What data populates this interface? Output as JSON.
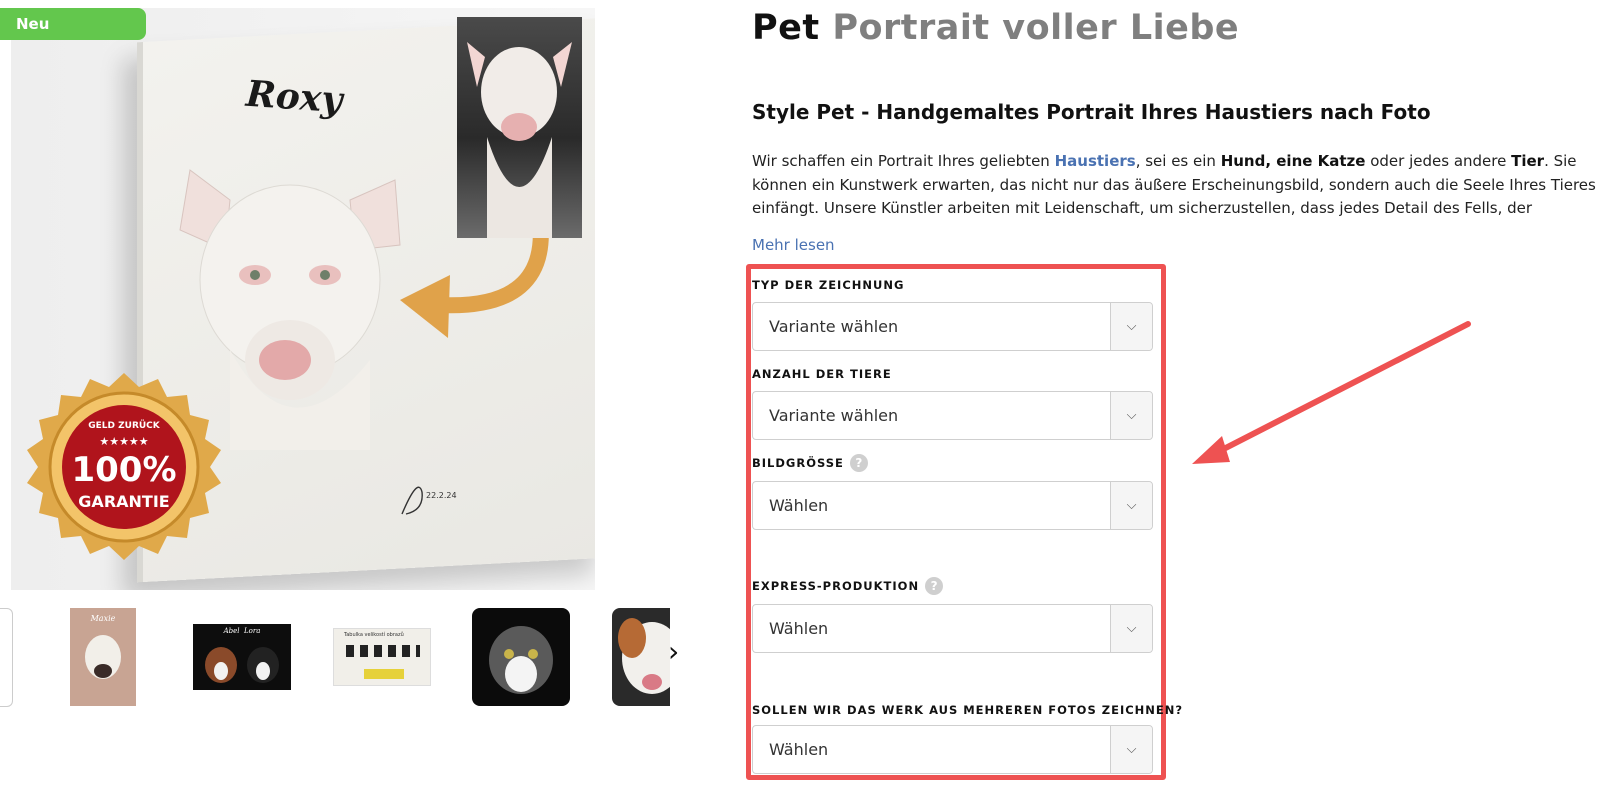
{
  "badge": {
    "new": "Neu"
  },
  "artwork": {
    "pet_name": "Roxy",
    "signature": "22.2.24",
    "seal_top": "GELD ZURÜCK",
    "seal_stars": "★★★★★",
    "seal_percent": "100%",
    "seal_bottom": "GARANTIE"
  },
  "thumbnails": [
    {
      "caption": ""
    },
    {
      "caption": "Maxie"
    },
    {
      "caption": "Abel  Lora"
    },
    {
      "caption": "Tabulka velikostí obrazů"
    },
    {
      "caption": ""
    },
    {
      "caption": ""
    }
  ],
  "product": {
    "title_part1": "Pet",
    "title_part2": "Portrait voller Liebe",
    "subtitle": "Style Pet - Handgemaltes Portrait Ihres Haustiers nach Foto",
    "desc": {
      "p1": "Wir schaffen ein Portrait Ihres geliebten ",
      "link1": "Haustiers",
      "p2": ", sei es ein ",
      "b1": "Hund, eine Katze",
      "p3": " oder jedes andere ",
      "b2": "Tier",
      "p4": ". Sie können ein Kunstwerk erwarten, das nicht nur das äußere Erscheinungsbild, sondern auch die Seele Ihres Tieres einfängt. Unsere Künstler arbeiten mit Leidenschaft, um sicherzustellen, dass jedes Detail des Fells, der glänzenden Augen und der"
    },
    "more": "Mehr lesen"
  },
  "options": [
    {
      "label": "TYP DER ZEICHNUNG",
      "value": "Variante wählen"
    },
    {
      "label": "ANZAHL DER TIERE",
      "value": "Variante wählen"
    },
    {
      "label": "BILDGRÖSSE",
      "value": "Wählen",
      "help": "?"
    },
    {
      "label": "EXPRESS-PRODUKTION",
      "value": "Wählen",
      "help": "?"
    },
    {
      "label": "SOLLEN WIR DAS WERK AUS MEHREREN FOTOS ZEICHNEN?",
      "value": "Wählen"
    }
  ],
  "icons": {
    "select_chevron": "chevron-down-icon",
    "thumb_next": "chevron-right-icon"
  },
  "colors": {
    "badge": "#63c74d",
    "link": "#4a72b2",
    "highlight": "#ee5252",
    "title_muted": "#7f7f7f"
  }
}
